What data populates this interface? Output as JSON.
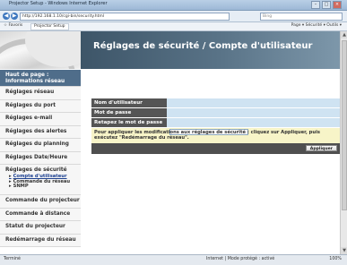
{
  "window": {
    "title": "Projector Setup - Windows Internet Explorer"
  },
  "address": {
    "url": "http://192.168.1.10/cgi-bin/security.html",
    "search_placeholder": "Bing"
  },
  "commandbar": {
    "favorites_label": "Favoris",
    "tab_label": "Projector Setup",
    "tools": "Page ▾  Sécurité ▾  Outils ▾"
  },
  "sidebar": {
    "items": [
      {
        "label": "Haut de page : Informations réseau"
      },
      {
        "label": "Réglages réseau"
      },
      {
        "label": "Réglages du port"
      },
      {
        "label": "Réglages e-mail"
      },
      {
        "label": "Réglages des alertes"
      },
      {
        "label": "Réglages du planning"
      },
      {
        "label": "Réglages Date/Heure"
      },
      {
        "label": "Réglages de sécurité"
      },
      {
        "label": "Commande du projecteur"
      },
      {
        "label": "Commande à distance"
      },
      {
        "label": "Statut du projecteur"
      },
      {
        "label": "Redémarrage du réseau"
      }
    ],
    "subitems": [
      {
        "label": "Compte d'utilisateur"
      },
      {
        "label": "Commande du réseau"
      },
      {
        "label": "SNMP"
      }
    ]
  },
  "main": {
    "title": "Réglages de sécurité / Compte d'utilisateur",
    "fields": [
      {
        "label": "Nom d'utilisateur",
        "value": "Administrator"
      },
      {
        "label": "Mot de passe",
        "value": ""
      },
      {
        "label": "Retapez le mot de passe",
        "value": ""
      }
    ],
    "note": "Pour appliquer les modifications aux réglages de sécurité : cliquez sur Appliquer, puis exécutez \"Redémarrage du réseau\".",
    "apply_label": "Appliquer"
  },
  "status": {
    "left": "Terminé",
    "zone": "Internet | Mode protégé : activé",
    "zoom": "100%"
  }
}
